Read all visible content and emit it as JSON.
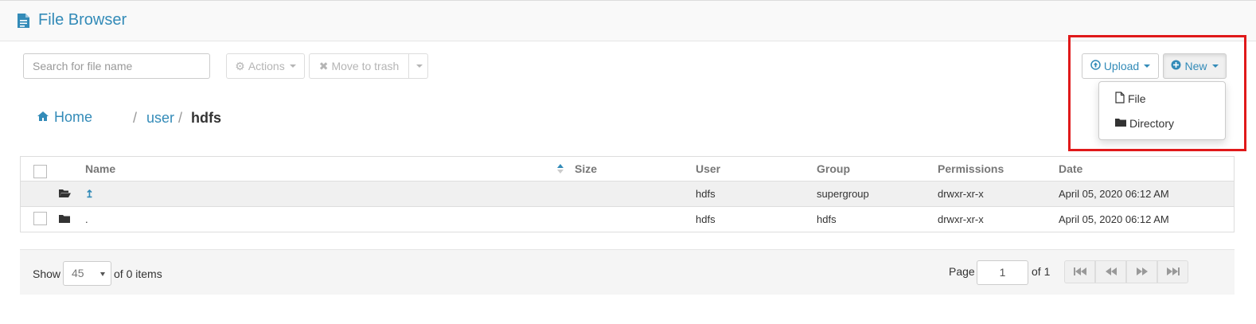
{
  "header": {
    "title": "File Browser",
    "icon": "document-icon"
  },
  "toolbar": {
    "search_placeholder": "Search for file name",
    "actions_label": "Actions",
    "move_to_trash_label": "Move to trash",
    "upload_label": "Upload",
    "new_label": "New"
  },
  "new_menu": {
    "items": [
      {
        "label": "File",
        "icon": "file-icon"
      },
      {
        "label": "Directory",
        "icon": "folder-icon"
      }
    ]
  },
  "breadcrumb": {
    "home": "Home",
    "sep1": "/",
    "user": "user",
    "sep2": "/",
    "current": "hdfs"
  },
  "table": {
    "columns": {
      "name": "Name",
      "size": "Size",
      "user": "User",
      "group": "Group",
      "permissions": "Permissions",
      "date": "Date"
    },
    "rows": [
      {
        "name": "↥",
        "size": "",
        "user": "hdfs",
        "group": "supergroup",
        "permissions": "drwxr-xr-x",
        "date": "April 05, 2020 06:12 AM",
        "icon": "folder-open-icon"
      },
      {
        "name": ".",
        "size": "",
        "user": "hdfs",
        "group": "hdfs",
        "permissions": "drwxr-xr-x",
        "date": "April 05, 2020 06:12 AM",
        "icon": "folder-icon"
      }
    ]
  },
  "footer": {
    "show_label": "Show",
    "page_size": "45",
    "items_label": "of 0 items",
    "page_label": "Page",
    "page_value": "1",
    "of_pages": "of 1"
  },
  "colors": {
    "accent": "#338bb8",
    "highlight": "#e0191a"
  }
}
